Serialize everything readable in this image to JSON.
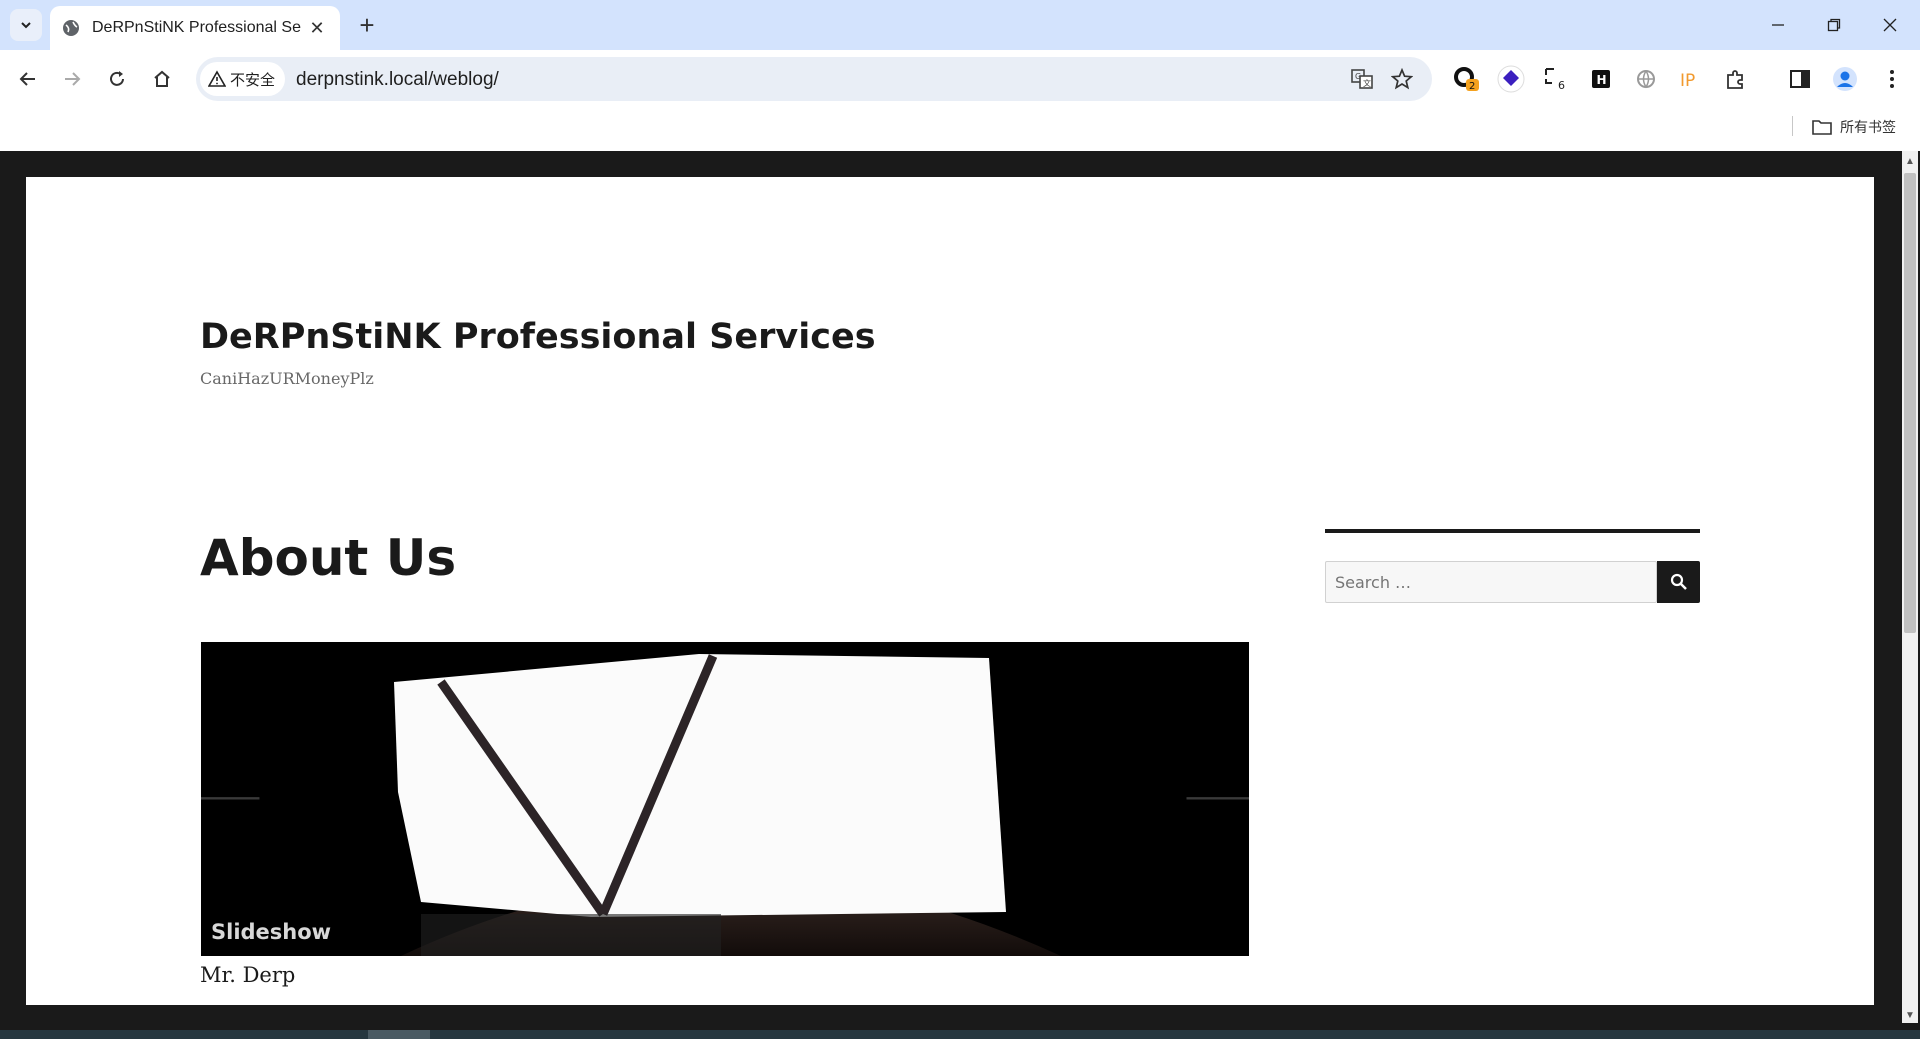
{
  "browser": {
    "tab": {
      "title": "DeRPnStiNK Professional Ser",
      "close_glyph": "✕"
    },
    "new_tab_glyph": "+",
    "omnibox": {
      "security_label": "不安全",
      "url": "derpnstink.local/weblog/"
    },
    "extensions": {
      "badge_2": "2",
      "badge_6": "6",
      "h_label": "H",
      "ip_label": "IP"
    },
    "bookmarks": {
      "all_label": "所有书签"
    }
  },
  "site": {
    "title": "DeRPnStiNK Professional Services",
    "tagline": "CaniHazURMoneyPlz"
  },
  "post": {
    "title": "About Us",
    "slideshow": {
      "caption": "Slideshow",
      "prev_glyph": "🡐",
      "next_glyph": "🡒"
    },
    "text": "Mr. Derp"
  },
  "sidebar": {
    "search": {
      "placeholder": "Search …"
    }
  },
  "colors": {
    "tabstrip": "#d3e3fd",
    "page_bg": "#1a1a1a",
    "content_bg": "#ffffff",
    "text_primary": "#1a1a1a"
  }
}
